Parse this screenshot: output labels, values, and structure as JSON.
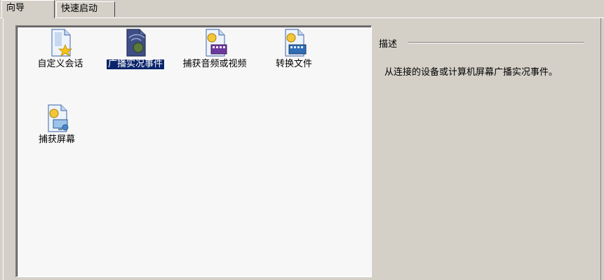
{
  "tabs": [
    {
      "label": "向导",
      "active": true
    },
    {
      "label": "快速启动",
      "active": false
    }
  ],
  "wizards": [
    {
      "label": "自定义会话",
      "icon": "document-star-icon",
      "selected": false
    },
    {
      "label": "广播实况事件",
      "icon": "broadcast-event-icon",
      "selected": true
    },
    {
      "label": "捕获音频或视频",
      "icon": "capture-audio-video-icon",
      "selected": false
    },
    {
      "label": "转换文件",
      "icon": "convert-file-icon",
      "selected": false
    },
    {
      "label": "捕获屏幕",
      "icon": "capture-screen-icon",
      "selected": false
    }
  ],
  "description": {
    "title": "描述",
    "text": "从连接的设备或计算机屏幕广播实况事件。"
  },
  "colors": {
    "selection": "#0a246a",
    "window": "#d4d0c8",
    "list_bg": "#f7f7f7"
  }
}
